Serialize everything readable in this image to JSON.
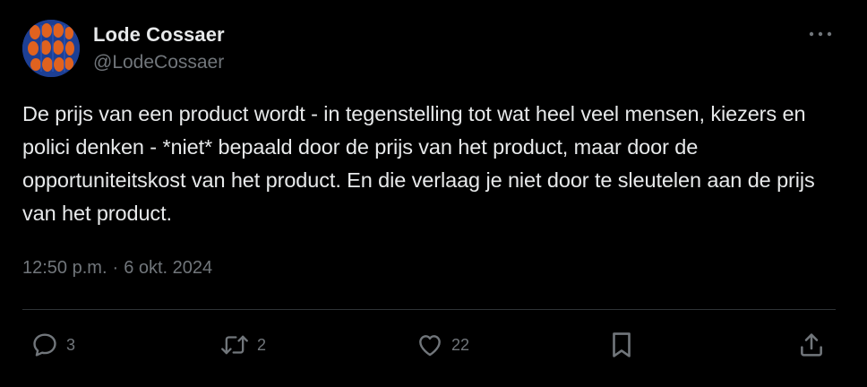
{
  "author": {
    "name": "Lode Cossaer",
    "handle": "@LodeCossaer",
    "avatar_icon": "avatar-image"
  },
  "tweet": {
    "text": "De prijs van een product wordt - in tegenstelling tot wat heel veel mensen, kiezers en polici denken - *niet* bepaald door de prijs van het product, maar door de opportuniteitskost van het product. En die verlaag je niet door te sleutelen aan de prijs van het product.",
    "time": "12:50 p.m.",
    "separator": "·",
    "date": "6 okt. 2024"
  },
  "actions": {
    "replies": "3",
    "reposts": "2",
    "likes": "22",
    "reply_icon": "reply-icon",
    "repost_icon": "repost-icon",
    "like_icon": "heart-icon",
    "bookmark_icon": "bookmark-icon",
    "share_icon": "share-icon"
  },
  "colors": {
    "background": "#000000",
    "text": "#e7e9ea",
    "muted": "#71767b",
    "divider": "#2f3336"
  }
}
